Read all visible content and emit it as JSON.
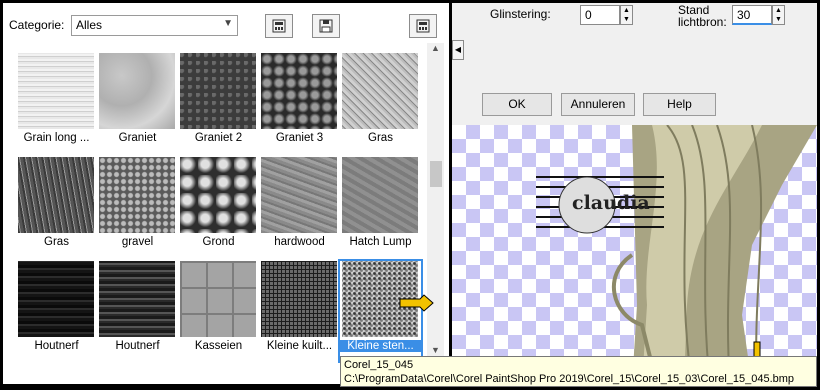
{
  "category": {
    "label": "Categorie:",
    "value": "Alles"
  },
  "thumbnails": [
    {
      "label": "Grain long ..."
    },
    {
      "label": "Graniet"
    },
    {
      "label": "Graniet 2"
    },
    {
      "label": "Graniet 3"
    },
    {
      "label": "Gras"
    },
    {
      "label": "Gras"
    },
    {
      "label": "gravel"
    },
    {
      "label": "Grond"
    },
    {
      "label": "hardwood"
    },
    {
      "label": "Hatch Lump"
    },
    {
      "label": "Houtnerf"
    },
    {
      "label": "Houtnerf"
    },
    {
      "label": "Kasseien"
    },
    {
      "label": "Kleine kuilt..."
    },
    {
      "label": "Kleine sten..."
    }
  ],
  "dialog": {
    "glinstering_label": "Glinstering:",
    "glinstering_value": "0",
    "stand_label_1": "Stand",
    "stand_label_2": "lichtbron:",
    "stand_value": "30",
    "ok_label": "OK",
    "cancel_label": "Annuleren",
    "help_label": "Help"
  },
  "canvas": {
    "watermark_text": "claudia"
  },
  "tooltip": {
    "name": "Corel_15_045",
    "path": "C:\\ProgramData\\Corel\\Corel PaintShop Pro 2019\\Corel_15\\Corel_15_03\\Corel_15_045.bmp"
  },
  "colors": {
    "selection": "#3a8ee6",
    "checker": "#c9c6f4",
    "tooltip_bg": "#ffffe1"
  }
}
